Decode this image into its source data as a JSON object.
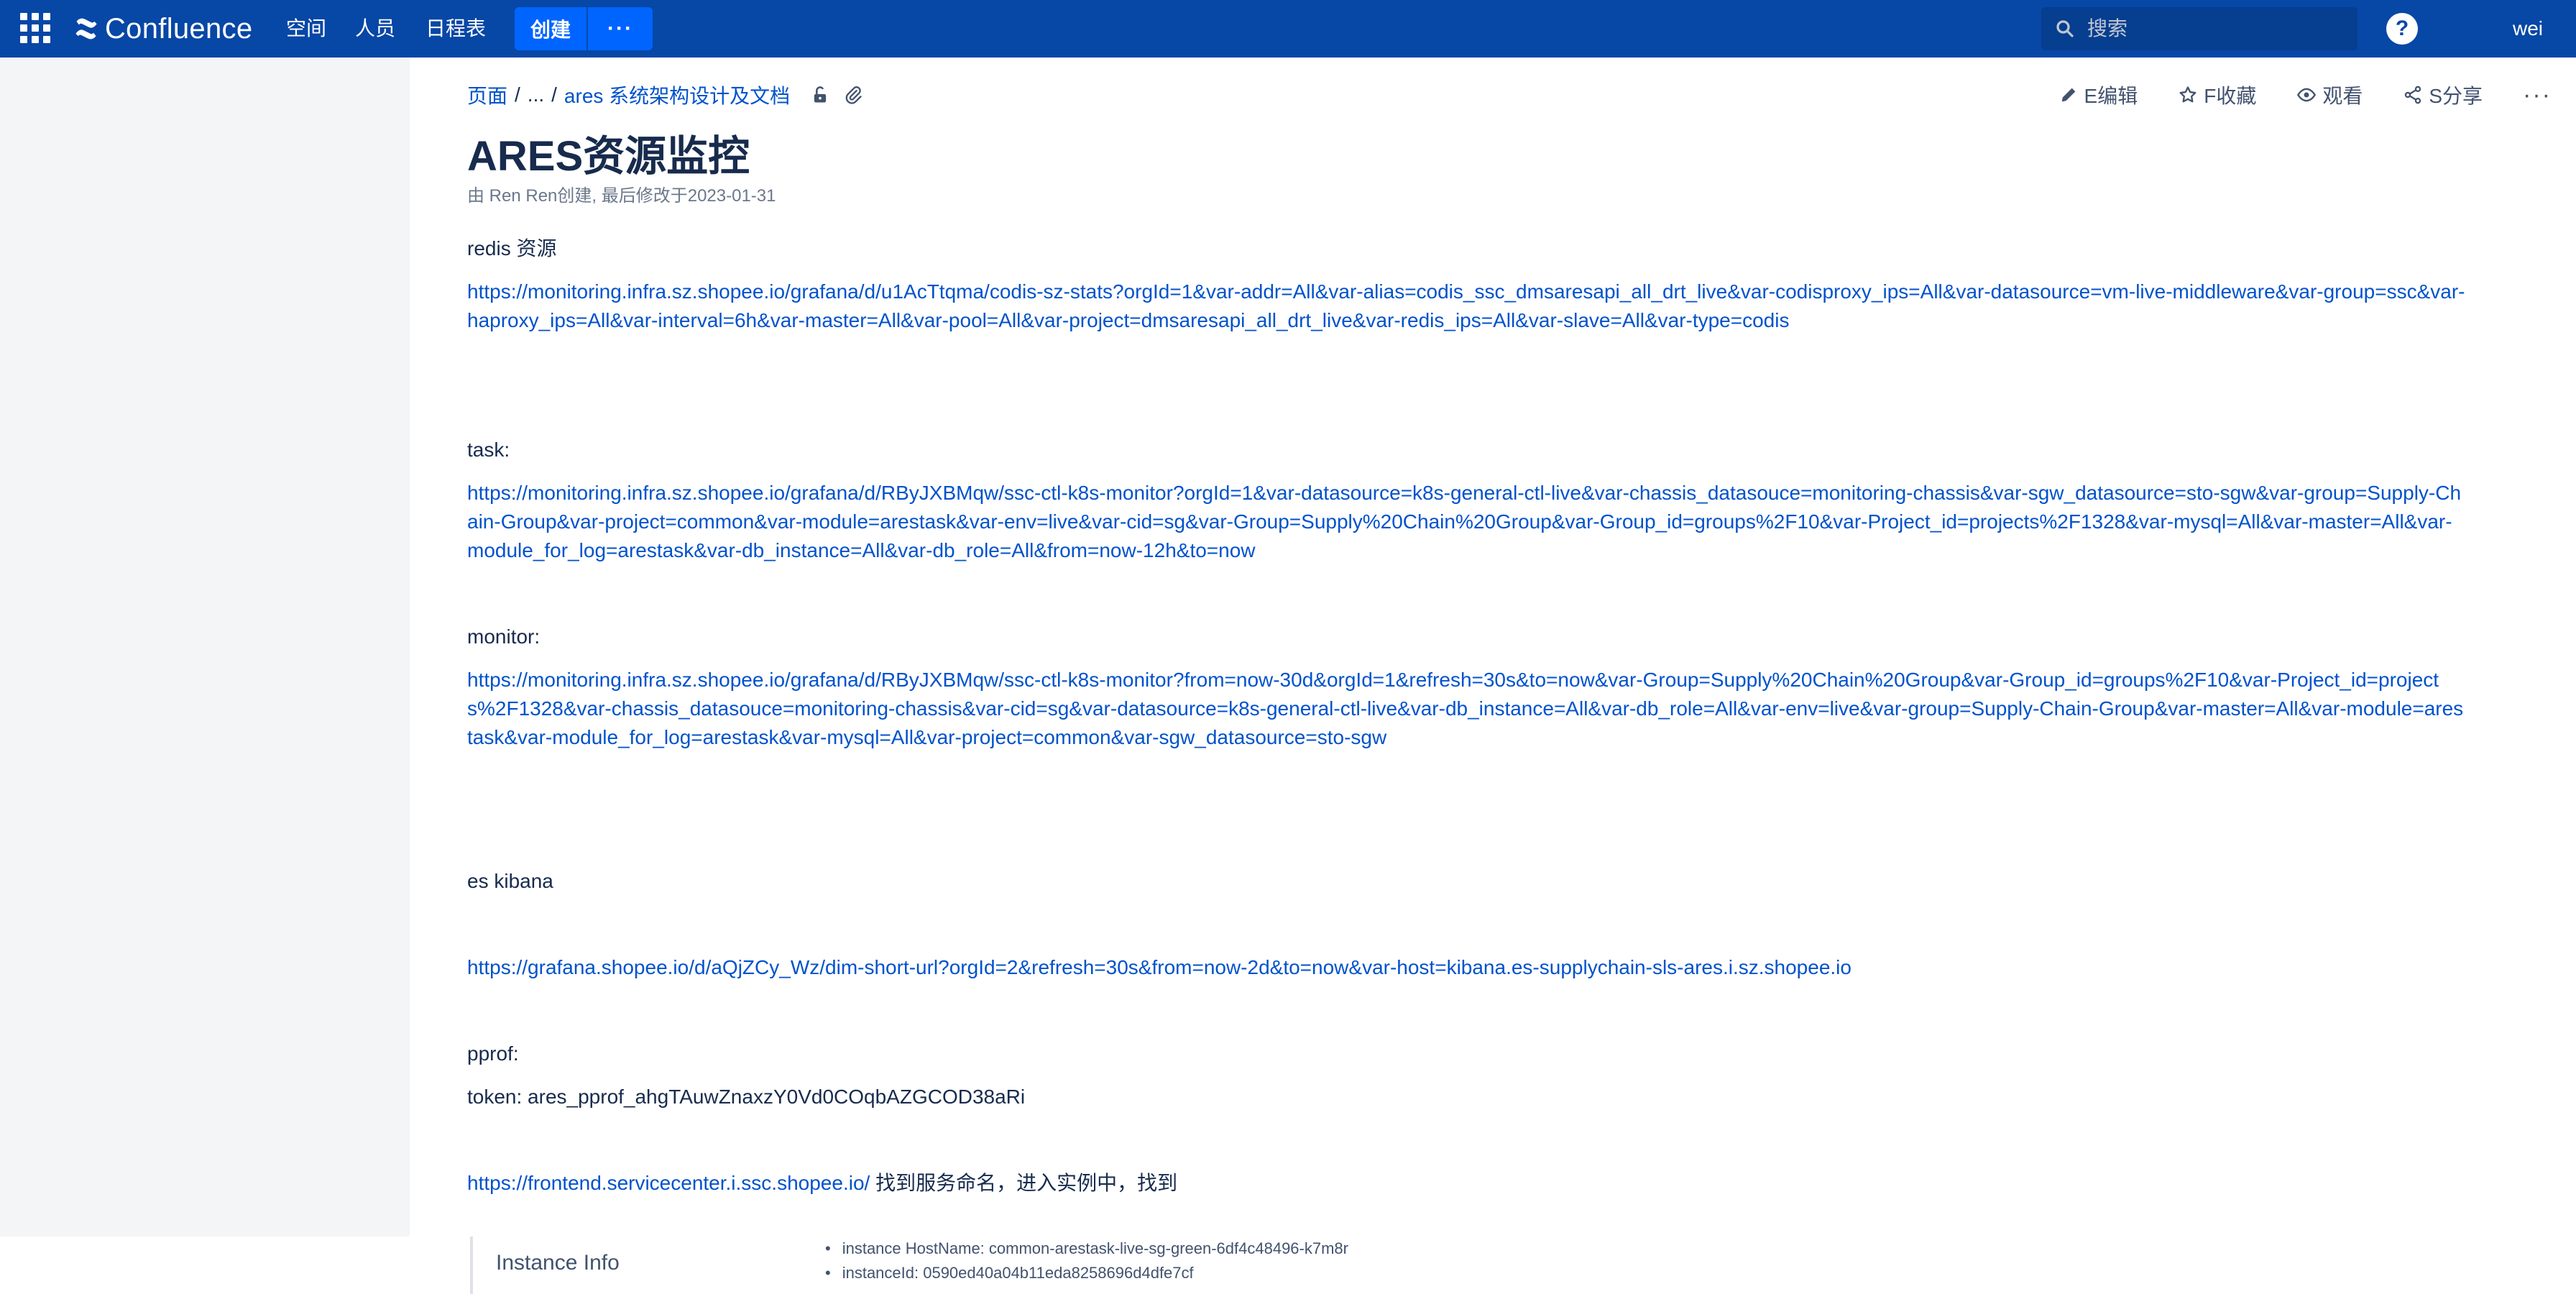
{
  "nav": {
    "logo_text": "Confluence",
    "items": [
      "空间",
      "人员",
      "日程表"
    ],
    "create_label": "创建",
    "more_label": "···",
    "search_placeholder": "搜索",
    "help_label": "?",
    "user_label": "wei"
  },
  "breadcrumb": {
    "root": "页面",
    "ellipsis": "...",
    "parent": "ares 系统架构设计及文档"
  },
  "actions": {
    "edit": "E编辑",
    "save": "F收藏",
    "watch": "观看",
    "share": "S分享",
    "more": "···"
  },
  "page": {
    "title": "ARES资源监控",
    "byline": "由 Ren Ren创建, 最后修改于2023-01-31"
  },
  "body": {
    "redis_label": "redis 资源",
    "redis_url": "https://monitoring.infra.sz.shopee.io/grafana/d/u1AcTtqma/codis-sz-stats?orgId=1&var-addr=All&var-alias=codis_ssc_dmsaresapi_all_drt_live&var-codisproxy_ips=All&var-datasource=vm-live-middleware&var-group=ssc&var-haproxy_ips=All&var-interval=6h&var-master=All&var-pool=All&var-project=dmsaresapi_all_drt_live&var-redis_ips=All&var-slave=All&var-type=codis",
    "task_label": "task:",
    "task_url": "https://monitoring.infra.sz.shopee.io/grafana/d/RByJXBMqw/ssc-ctl-k8s-monitor?orgId=1&var-datasource=k8s-general-ctl-live&var-chassis_datasouce=monitoring-chassis&var-sgw_datasource=sto-sgw&var-group=Supply-Chain-Group&var-project=common&var-module=arestask&var-env=live&var-cid=sg&var-Group=Supply%20Chain%20Group&var-Group_id=groups%2F10&var-Project_id=projects%2F1328&var-mysql=All&var-master=All&var-module_for_log=arestask&var-db_instance=All&var-db_role=All&from=now-12h&to=now",
    "monitor_label": "monitor:",
    "monitor_url": "https://monitoring.infra.sz.shopee.io/grafana/d/RByJXBMqw/ssc-ctl-k8s-monitor?from=now-30d&orgId=1&refresh=30s&to=now&var-Group=Supply%20Chain%20Group&var-Group_id=groups%2F10&var-Project_id=projects%2F1328&var-chassis_datasouce=monitoring-chassis&var-cid=sg&var-datasource=k8s-general-ctl-live&var-db_instance=All&var-db_role=All&var-env=live&var-group=Supply-Chain-Group&var-master=All&var-module=arestask&var-module_for_log=arestask&var-mysql=All&var-project=common&var-sgw_datasource=sto-sgw",
    "es_label": "es  kibana",
    "es_url": "https://grafana.shopee.io/d/aQjZCy_Wz/dim-short-url?orgId=2&refresh=30s&from=now-2d&to=now&var-host=kibana.es-supplychain-sls-ares.i.sz.shopee.io",
    "pprof_label": "pprof:",
    "token_line": "token: ares_pprof_ahgTAuwZnaxzY0Vd0COqbAZGCOD38aRi",
    "frontend_url": "https://frontend.servicecenter.i.ssc.shopee.io/",
    "frontend_note": " 找到服务命名，进入实例中，找到"
  },
  "instance_info": {
    "title": "Instance Info",
    "items": [
      "instance HostName: common-arestask-live-sg-green-6df4c48496-k7m8r",
      "instanceId: 0590ed40a04b11eda8258696d4dfe7cf"
    ]
  },
  "colors": {
    "topbar": "#0747a6",
    "create_button": "#0065ff",
    "link": "#0052cc",
    "sidebar": "#f4f5f7",
    "text": "#172b4d"
  }
}
